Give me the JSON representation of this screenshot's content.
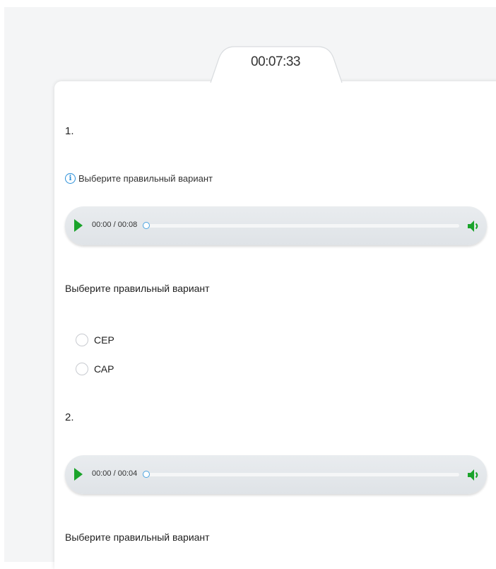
{
  "timer": "00:07:33",
  "questions": [
    {
      "number": "1.",
      "hint": "Выберите правильный вариант",
      "audio": {
        "time": "00:00 / 00:08",
        "progress": 0
      },
      "prompt": "Выберите правильный вариант",
      "options": [
        "СЕР",
        "САР"
      ]
    },
    {
      "number": "2.",
      "audio": {
        "time": "00:00 / 00:04",
        "progress": 0
      },
      "prompt": "Выберите правильный вариант"
    }
  ],
  "icons": {
    "info": "info-icon",
    "play": "play-icon",
    "volume": "speaker-icon"
  },
  "colors": {
    "accent_green": "#1aa32a",
    "info_blue": "#2a8fd8"
  }
}
